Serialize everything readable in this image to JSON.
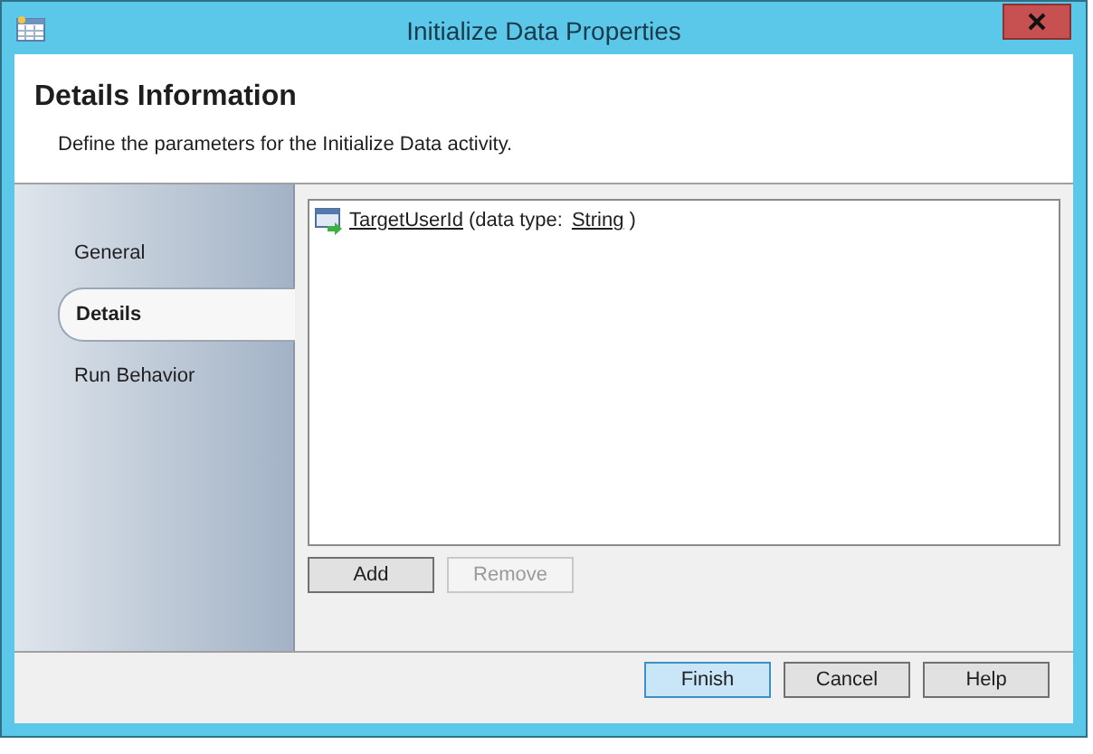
{
  "window": {
    "title": "Initialize Data Properties"
  },
  "header": {
    "title": "Details Information",
    "subtitle": "Define the parameters for the Initialize Data activity."
  },
  "sidebar": {
    "items": [
      {
        "label": "General",
        "selected": false
      },
      {
        "label": "Details",
        "selected": true
      },
      {
        "label": "Run Behavior",
        "selected": false
      }
    ]
  },
  "parameters": [
    {
      "name": "TargetUserId",
      "type_prefix": "(data type:",
      "type": "String",
      "suffix": ")"
    }
  ],
  "list_buttons": [
    {
      "label": "Add",
      "disabled": false
    },
    {
      "label": "Remove",
      "disabled": true
    }
  ],
  "footer_buttons": [
    {
      "label": "Finish",
      "default": true
    },
    {
      "label": "Cancel",
      "default": false
    },
    {
      "label": "Help",
      "default": false
    }
  ]
}
